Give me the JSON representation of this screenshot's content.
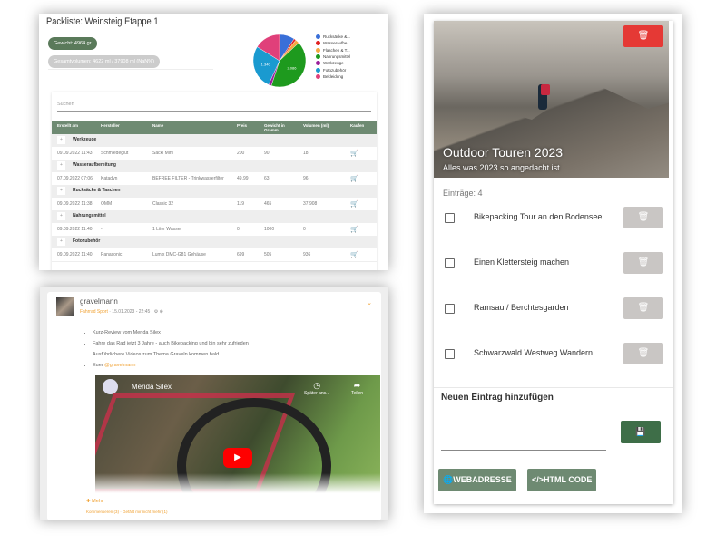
{
  "packlist": {
    "title": "Packliste: Weinsteig Etappe 1",
    "weight_badge": "Gewicht: 4964 gr",
    "volume_badge": "Gesamtvolumen: 4622 ml / 37908 ml (NaN%)",
    "search_placeholder": "Suchen",
    "columns": [
      "Erstellt am",
      "Hersteller",
      "Name",
      "Preis",
      "Gewicht in Gramm",
      "Volumen (ml)",
      "Kaufen"
    ],
    "groups": [
      {
        "name": "Werkzeuge",
        "rows": [
          [
            "09.09.2022 11:43",
            "Schmiedeglut",
            "Sacki Mini",
            "200",
            "90",
            "18"
          ]
        ]
      },
      {
        "name": "Wasseraufbereitung",
        "rows": [
          [
            "07.09.2022 07:06",
            "Katadyn",
            "BEFREE FILTER - Trinkwasserfilter",
            "49.99",
            "63",
            "96"
          ]
        ]
      },
      {
        "name": "Rucksäcke & Taschen",
        "rows": [
          [
            "09.09.2022 11:38",
            "OMM",
            "Classic 32",
            "119",
            "465",
            "37.908"
          ]
        ]
      },
      {
        "name": "Nahrungsmittel",
        "rows": [
          [
            "09.09.2022 11:40",
            "-",
            "1 Liter Wasser",
            "0",
            "1000",
            "0"
          ]
        ]
      },
      {
        "name": "Fotozubehör",
        "rows": [
          [
            "09.09.2022 11:40",
            "Panasonic",
            "Lumix DMC-G81 Gehäuse",
            "699",
            "505",
            "936"
          ]
        ]
      }
    ],
    "chart_data": {
      "type": "pie",
      "legend_position": "right",
      "slice_labels": [
        "1.340",
        "2.086"
      ],
      "slices": [
        {
          "name": "Rucksäcke &...",
          "value": 465,
          "color": "#3a6fd8"
        },
        {
          "name": "Wasseraufbe...",
          "value": 63,
          "color": "#e02020"
        },
        {
          "name": "Flaschen & T...",
          "value": 120,
          "color": "#f5a840"
        },
        {
          "name": "Nahrungsmittel",
          "value": 2086,
          "color": "#1e9a1e"
        },
        {
          "name": "Werkzeuge",
          "value": 90,
          "color": "#9a1e9a"
        },
        {
          "name": "Fotozubehör",
          "value": 1340,
          "color": "#1a9ad0"
        },
        {
          "name": "Bekleidung",
          "value": 800,
          "color": "#e0407a"
        }
      ]
    }
  },
  "post": {
    "username": "gravelmann",
    "category": "Fahrrad Sport",
    "meta": " · 15.01.2023 - 22:45 · ⚙ ⊕",
    "bullets": [
      "Kurz-Review vom Merida Silex",
      "Fahre das Rad jetzt 3 Jahre - auch Bikepacking und bin sehr zufrieden",
      "Ausführlichere Videos zum Thema Graveln kommen bald"
    ],
    "sign_prefix": "Euer ",
    "sign_link": "@gravelmann",
    "video_title": "Merida Silex",
    "watch_later": "Später ans...",
    "share": "Teilen",
    "more": "✚ Mehr",
    "comment": "Kommentieren (3)",
    "dislike": "Gefällt mir nicht mehr (1)"
  },
  "list": {
    "title": "Outdoor Touren 2023",
    "subtitle": "Alles was 2023 so angedacht ist",
    "count": "Einträge: 4",
    "items": [
      "Bikepacking Tour an den Bodensee",
      "Einen Klettersteig machen",
      "Ramsau / Berchtesgarden",
      "Schwarzwald Westweg Wandern"
    ],
    "new_heading": "Neuen Eintrag hinzufügen",
    "new_value": "",
    "web_button": "WEBADRESSE",
    "html_button": "HTML CODE"
  }
}
